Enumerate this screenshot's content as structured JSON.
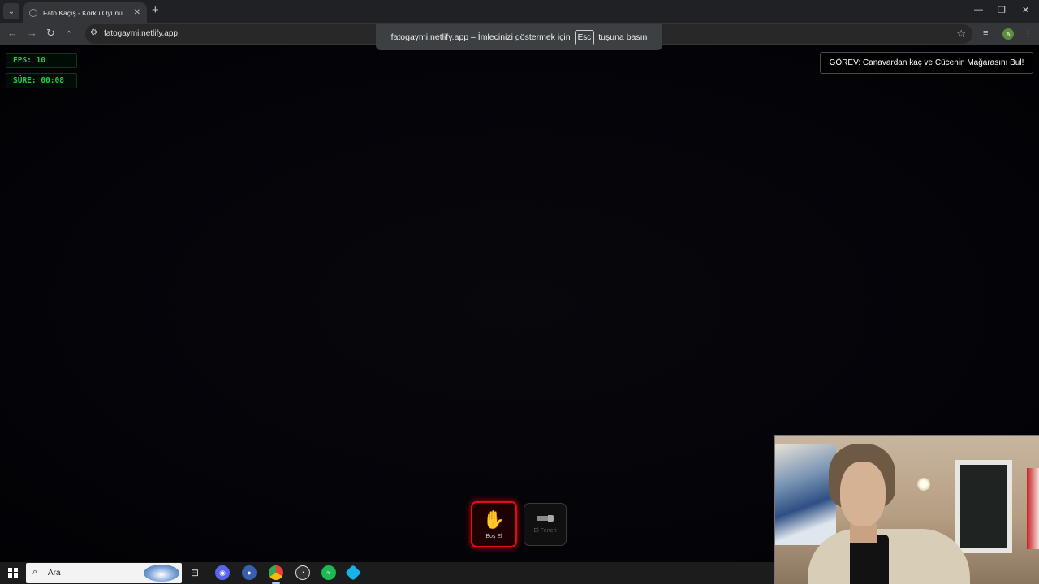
{
  "browser": {
    "tab_title": "Fato Kaçış - Korku Oyunu",
    "tab_close": "✕",
    "new_tab": "+",
    "url": "fatogaymi.netlify.app",
    "profile_initial": "A",
    "window_controls": {
      "minimize": "—",
      "restore": "❐",
      "close": "✕"
    }
  },
  "fullscreen_notice": {
    "prefix": "fatogaymi.netlify.app – İmlecinizi göstermek için",
    "key": "Esc",
    "suffix": "tuşuna basın"
  },
  "hud": {
    "fps": "FPS: 10",
    "time": "SÜRE: 00:08"
  },
  "mission": "GÖREV: Canavardan kaç ve Cücenin Mağarasını Bul!",
  "inventory": [
    {
      "label": "Boş El",
      "icon": "hand-icon",
      "selected": true,
      "glyph": "✋"
    },
    {
      "label": "El Feneri",
      "icon": "flashlight-icon",
      "selected": false
    }
  ],
  "taskbar": {
    "search_placeholder": "Ara",
    "apps": [
      "task-view",
      "discord",
      "app-blue",
      "chrome",
      "app-clock",
      "spotify",
      "app-kodi"
    ]
  },
  "colors": {
    "hud_green": "#22d13a",
    "slot_selected": "#e00d1a",
    "game_bg": "#040409"
  }
}
